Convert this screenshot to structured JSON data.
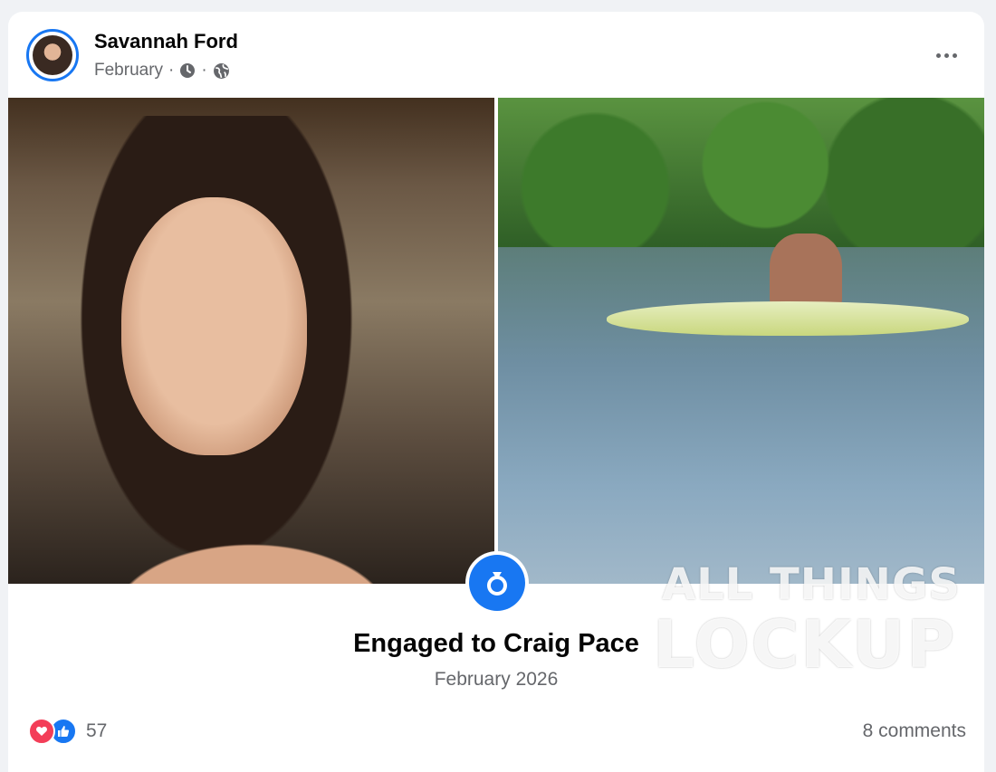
{
  "post": {
    "author": "Savannah Ford",
    "timestamp": "February",
    "audience_icon": "globe-icon",
    "clock_icon": "clock-icon",
    "separator": "·"
  },
  "life_event": {
    "icon": "ring-icon",
    "title": "Engaged to Craig Pace",
    "date": "February 2026",
    "accent_color": "#1877f2"
  },
  "watermark": {
    "line1": "ALL THINGS",
    "line2": "LOCKUP"
  },
  "footer": {
    "reaction_icons": [
      "love-reaction-icon",
      "like-reaction-icon"
    ],
    "reaction_count": "57",
    "comments": "8 comments"
  }
}
